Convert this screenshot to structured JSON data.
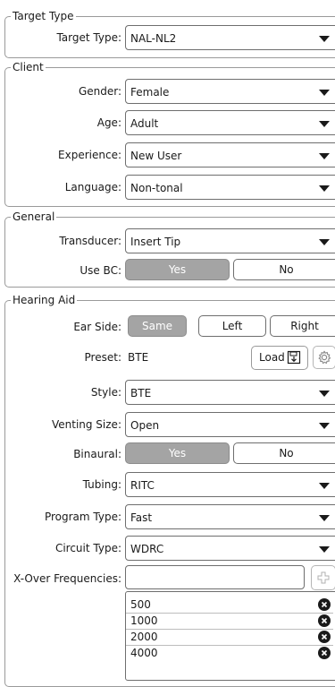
{
  "target_type": {
    "group_title": "Target Type",
    "label": "Target Type:",
    "value": "NAL-NL2"
  },
  "client": {
    "group_title": "Client",
    "gender": {
      "label": "Gender:",
      "value": "Female"
    },
    "age": {
      "label": "Age:",
      "value": "Adult"
    },
    "experience": {
      "label": "Experience:",
      "value": "New User"
    },
    "language": {
      "label": "Language:",
      "value": "Non-tonal"
    }
  },
  "general": {
    "group_title": "General",
    "transducer": {
      "label": "Transducer:",
      "value": "Insert Tip"
    },
    "use_bc": {
      "label": "Use BC:",
      "yes": "Yes",
      "no": "No",
      "selected": "Yes"
    }
  },
  "hearing_aid": {
    "group_title": "Hearing Aid",
    "ear_side": {
      "label": "Ear Side:",
      "options": [
        "Same",
        "Left",
        "Right"
      ],
      "selected": "Same"
    },
    "preset": {
      "label": "Preset:",
      "value": "BTE",
      "load_label": "Load",
      "load_icon": "save-icon",
      "settings_icon": "gear-icon"
    },
    "style": {
      "label": "Style:",
      "value": "BTE"
    },
    "venting_size": {
      "label": "Venting Size:",
      "value": "Open"
    },
    "binaural": {
      "label": "Binaural:",
      "yes": "Yes",
      "no": "No",
      "selected": "Yes"
    },
    "tubing": {
      "label": "Tubing:",
      "value": "RITC"
    },
    "program_type": {
      "label": "Program Type:",
      "value": "Fast"
    },
    "circuit_type": {
      "label": "Circuit Type:",
      "value": "WDRC"
    },
    "xover": {
      "label": "X-Over Frequencies:",
      "input_value": "",
      "add_icon": "plus-icon",
      "remove_icon": "remove-circle-icon",
      "frequencies": [
        "500",
        "1000",
        "2000",
        "4000"
      ]
    }
  },
  "colors": {
    "selected_segment": "#a4a4a4",
    "border": "#6e6e6e",
    "group_border": "#9a9a9a"
  }
}
